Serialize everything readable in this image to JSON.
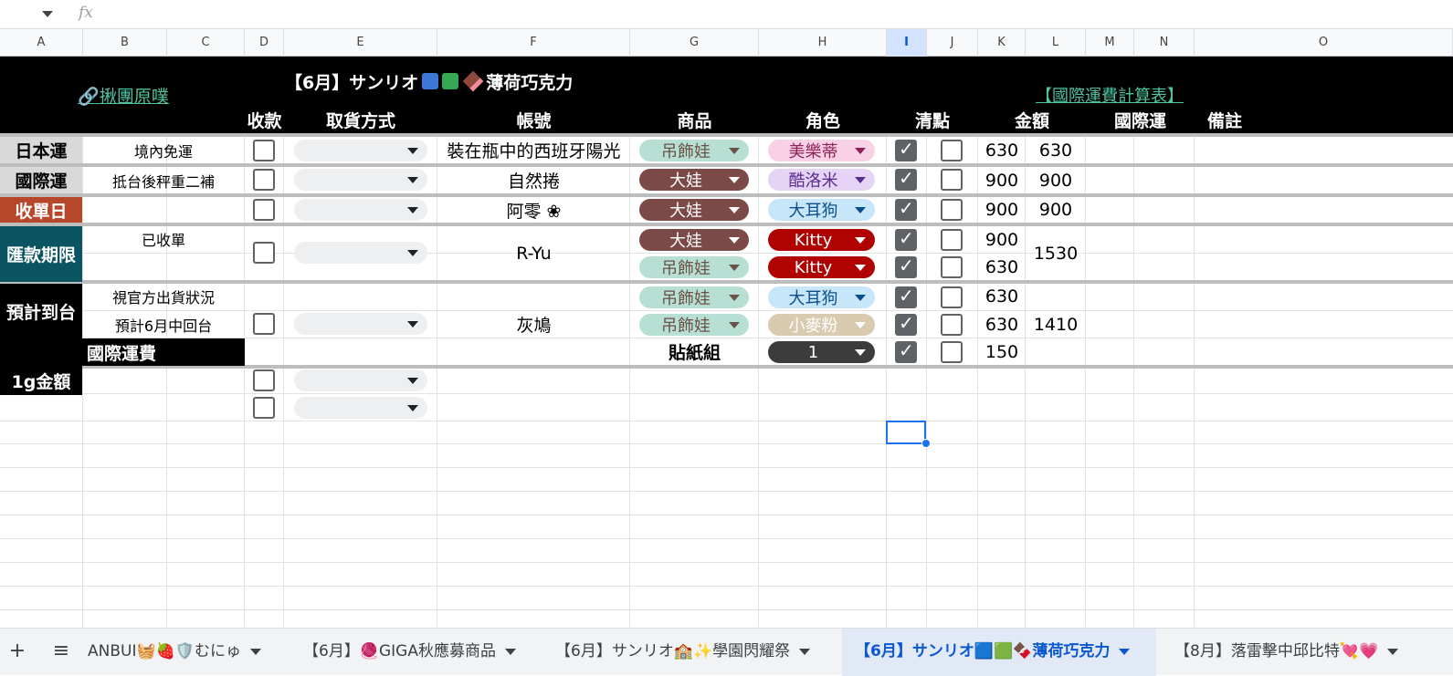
{
  "formula_bar": {
    "name_box": "",
    "fx_label": "fx"
  },
  "columns": [
    "A",
    "B",
    "C",
    "D",
    "E",
    "F",
    "G",
    "H",
    "I",
    "J",
    "K",
    "L",
    "M",
    "N",
    "O"
  ],
  "header": {
    "link_left": "🔗揪團原噗",
    "title_prefix": "【6月】サンリオ",
    "title_suffix": "薄荷巧克力",
    "link_right": "【國際運費計算表】",
    "cols": {
      "collect": "收款",
      "pickup": "取貨方式",
      "account": "帳號",
      "product": "商品",
      "character": "角色",
      "check": "清點",
      "amount": "金額",
      "intl": "國際運",
      "note": "備註"
    }
  },
  "info": [
    {
      "label": "日本運",
      "value": "境內免運"
    },
    {
      "label": "國際運",
      "value": "抵台後秤重二補"
    },
    {
      "label": "收單日",
      "value": "已收單"
    },
    {
      "label": "匯款期限",
      "value": ""
    },
    {
      "label": "預計到台",
      "value": "視官方出貨狀況",
      "value2": "預計6月中回台"
    },
    {
      "label": "國際運費",
      "value": ""
    },
    {
      "label": "1g金額",
      "value": ""
    }
  ],
  "orders": [
    {
      "account": "裝在瓶中的西班牙陽光",
      "total": "630",
      "items": [
        {
          "product": "吊飾娃",
          "character": "美樂蒂",
          "amount": "630",
          "checked": true
        }
      ]
    },
    {
      "account": "自然捲",
      "total": "900",
      "items": [
        {
          "product": "大娃",
          "character": "酷洛米",
          "amount": "900",
          "checked": true
        }
      ]
    },
    {
      "account": "阿零 ❀",
      "total": "900",
      "items": [
        {
          "product": "大娃",
          "character": "大耳狗",
          "amount": "900",
          "checked": true
        }
      ]
    },
    {
      "account": "R-Yu",
      "total": "1530",
      "items": [
        {
          "product": "大娃",
          "character": "Kitty",
          "amount": "900",
          "checked": true
        },
        {
          "product": "吊飾娃",
          "character": "Kitty",
          "amount": "630",
          "checked": true
        }
      ]
    },
    {
      "account": "灰鳩",
      "total": "1410",
      "items": [
        {
          "product": "吊飾娃",
          "character": "大耳狗",
          "amount": "630",
          "checked": true
        },
        {
          "product": "吊飾娃",
          "character": "小麥粉",
          "amount": "630",
          "checked": true
        },
        {
          "product": "貼紙組",
          "character": "1",
          "amount": "150",
          "checked": true
        }
      ]
    }
  ],
  "tabs": {
    "add": "+",
    "menu": "≡",
    "items": [
      "ANBUI🧺🍓🛡️むにゅ",
      "【6月】🧶GIGA秋應募商品",
      "【6月】サンリオ🏫✨學園閃耀祭",
      "【6月】サンリオ🟦🟩🍫薄荷巧克力",
      "【8月】落雷擊中邱比特💘💗"
    ],
    "active_index": 3
  },
  "colors": {
    "accent": "#0b57d0",
    "link": "#4fc3a1",
    "header_bg": "#000000",
    "red_label": "#b7472a",
    "teal_label": "#0b5563"
  }
}
